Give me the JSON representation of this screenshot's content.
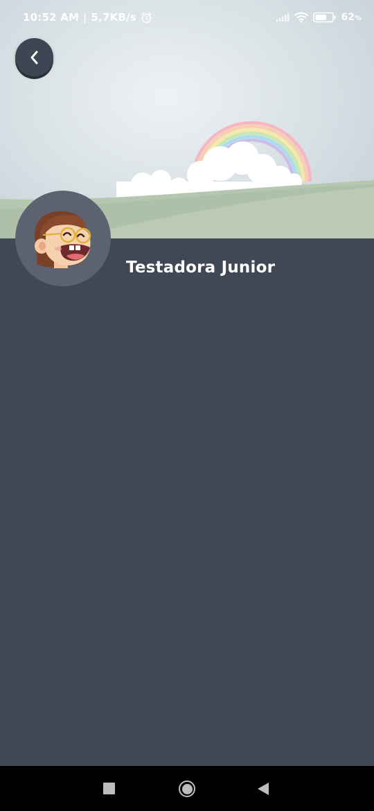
{
  "status_bar": {
    "time": "10:52 AM",
    "separator": "|",
    "network_speed": "5,7KB/s",
    "battery_percent": "62",
    "battery_unit": "%"
  },
  "profile": {
    "name": "Testadora Junior"
  },
  "icons": {
    "back": "chevron-left-icon",
    "alarm": "alarm-icon",
    "signal": "signal-icon",
    "wifi": "wifi-icon",
    "battery": "battery-icon",
    "nav_recents": "square-icon",
    "nav_home": "circle-icon",
    "nav_back": "triangle-back-icon"
  },
  "colors": {
    "background": "#414855",
    "avatar_bg": "#5c6270",
    "back_button": "#3f4653",
    "hill": "#b6c7b0",
    "nav_bar": "#000000"
  }
}
